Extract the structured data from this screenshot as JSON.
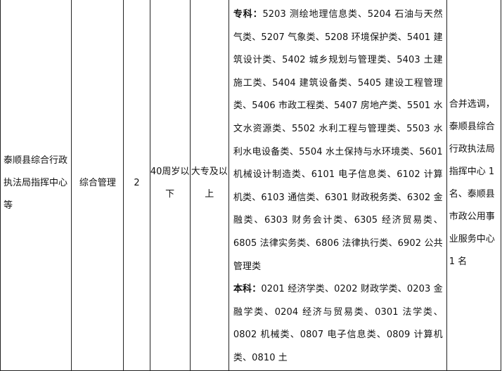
{
  "row": {
    "unit": "泰顺县综合行政执法局指挥中心等",
    "position": "综合管理",
    "count": "2",
    "age": "40周岁以下",
    "education": "大专及以上",
    "major_zhuanke_label": "专科：",
    "major_zhuanke": "5203 测绘地理信息类、5204 石油与天然气类、5207 气象类、5208 环境保护类、5401 建筑设计类、5402 城乡规划与管理类、5403 土建施工类、5404 建筑设备类、5405 建设工程管理类、5406 市政工程类、5407 房地产类、5501 水文水资源类、5502 水利工程与管理类、5503 水利水电设备类、5504 水土保持与水环境类、5601 机械设计制造类、6101 电子信息类、6102 计算机类、6103 通信类、6301 财政税务类、6302 金融类、6303 财务会计类、6305 经济贸易类、6805 法律实务类、6806 法律执行类、6902 公共管理类",
    "major_benke_label": "本科：",
    "major_benke": "0201 经济学类、0202 财政学类、0203 金融学类、0204 经济与贸易类、0301 法学类、0802 机械类、0807 电子信息类、0809 计算机类、0810 土",
    "remark": "合并选调，泰顺县综合行政执法局指挥中心 1 名、泰顺县市政公用事业服务中心 1 名"
  }
}
